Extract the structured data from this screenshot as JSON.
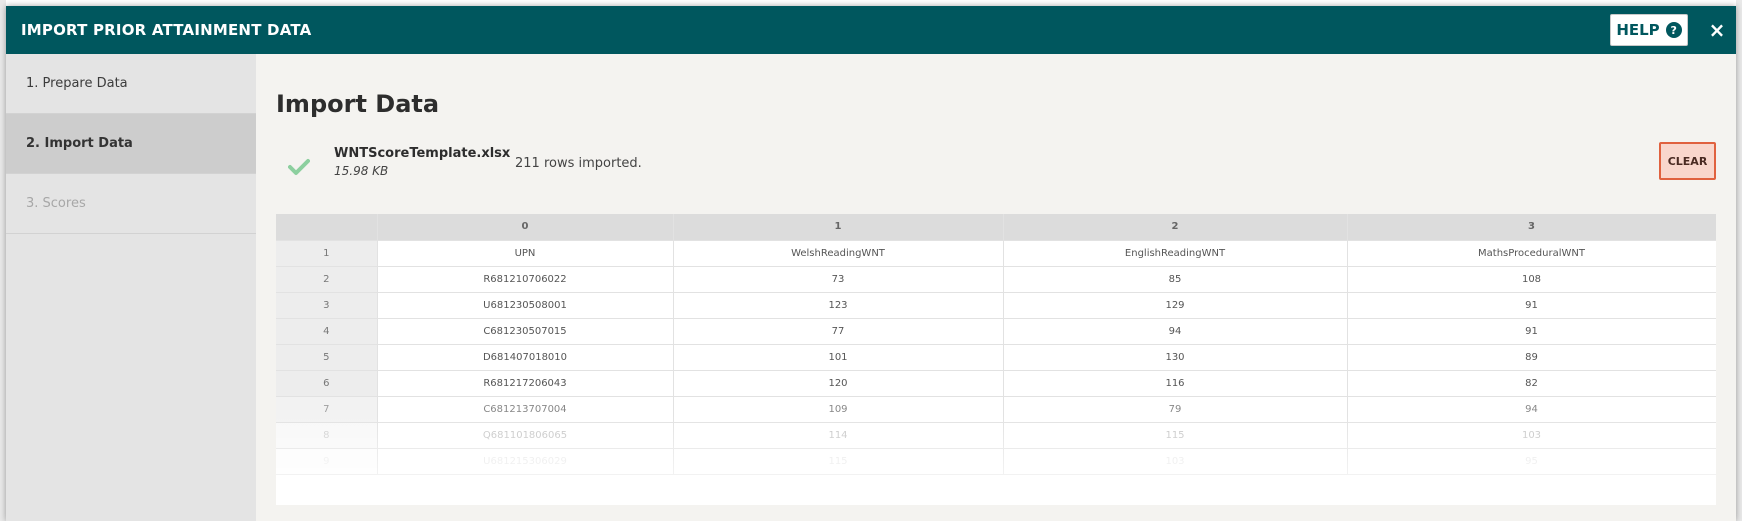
{
  "modal": {
    "title": "IMPORT PRIOR ATTAINMENT DATA",
    "help_label": "HELP",
    "close_label": "×"
  },
  "steps": [
    {
      "label": "1. Prepare Data",
      "state": "done"
    },
    {
      "label": "2. Import Data",
      "state": "active"
    },
    {
      "label": "3. Scores",
      "state": "disabled"
    }
  ],
  "main": {
    "title": "Import Data",
    "file": {
      "name": "WNTScoreTemplate.xlsx",
      "size": "15.98 KB",
      "status": "211 rows imported."
    },
    "clear_label": "CLEAR"
  },
  "table": {
    "column_headers": [
      "",
      "0",
      "1",
      "2",
      "3"
    ],
    "rows": [
      [
        "1",
        "UPN",
        "WelshReadingWNT",
        "EnglishReadingWNT",
        "MathsProceduralWNT"
      ],
      [
        "2",
        "R681210706022",
        "73",
        "85",
        "108"
      ],
      [
        "3",
        "U681230508001",
        "123",
        "129",
        "91"
      ],
      [
        "4",
        "C681230507015",
        "77",
        "94",
        "91"
      ],
      [
        "5",
        "D681407018010",
        "101",
        "130",
        "89"
      ],
      [
        "6",
        "R681217206043",
        "120",
        "116",
        "82"
      ],
      [
        "7",
        "C681213707004",
        "109",
        "79",
        "94"
      ],
      [
        "8",
        "Q681101806065",
        "114",
        "115",
        "103"
      ],
      [
        "9",
        "U681215306029",
        "115",
        "103",
        "95"
      ]
    ]
  },
  "colors": {
    "header_bg": "#00575e",
    "clear_bg": "#f9d6cc",
    "clear_border": "#e0613f",
    "check": "#8ccf9f"
  }
}
